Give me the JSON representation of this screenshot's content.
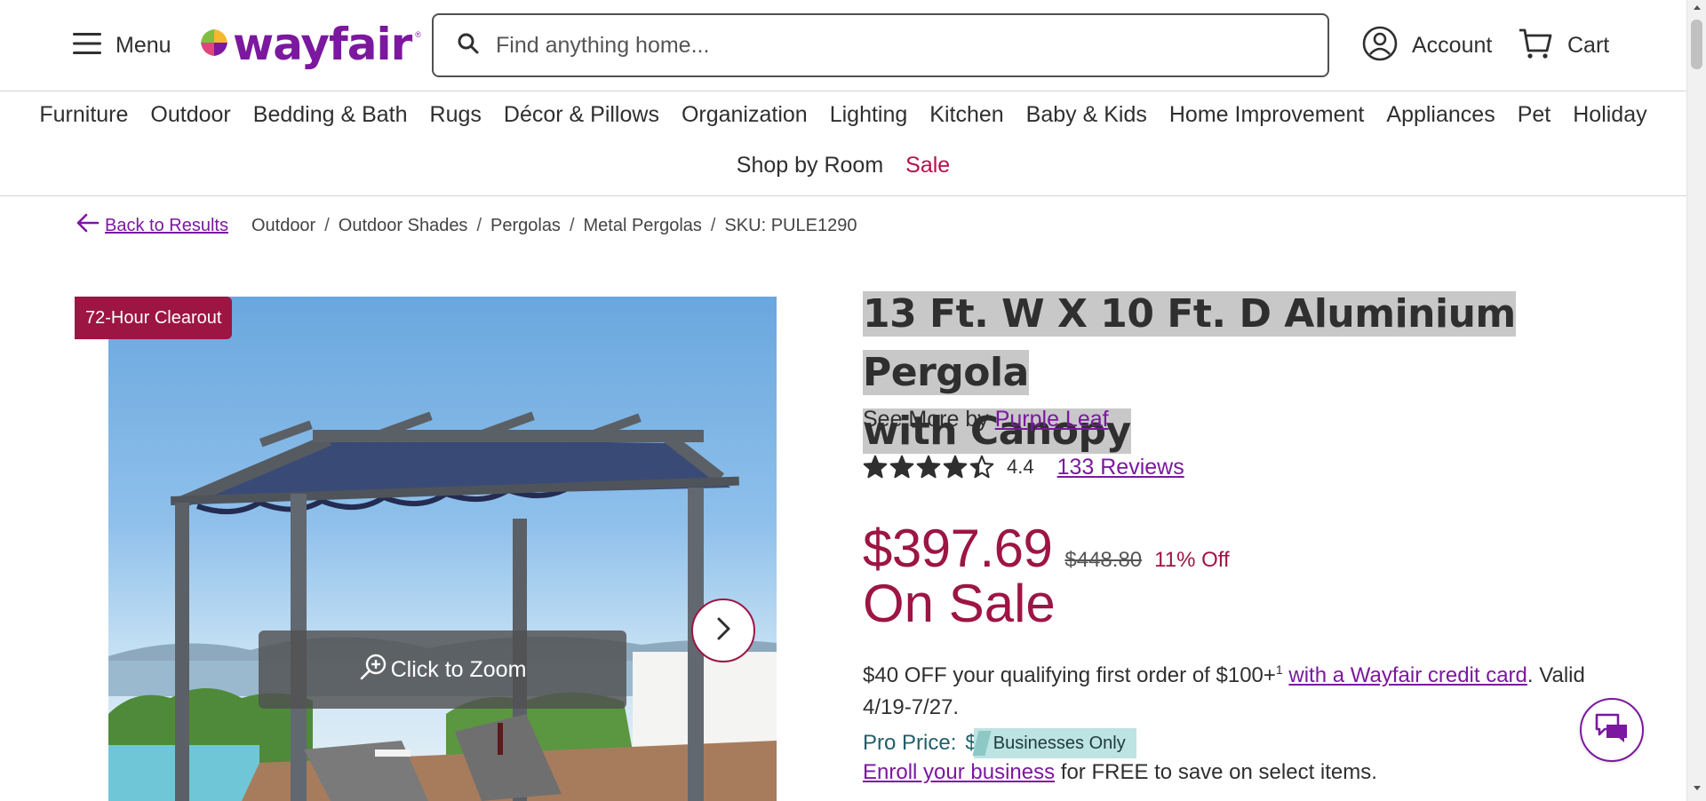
{
  "header": {
    "menu_label": "Menu",
    "logo_text": "wayfair",
    "logo_mark": "®",
    "search_placeholder": "Find anything home...",
    "account_label": "Account",
    "cart_label": "Cart"
  },
  "categories": {
    "row1": [
      "Furniture",
      "Outdoor",
      "Bedding & Bath",
      "Rugs",
      "Décor & Pillows",
      "Organization",
      "Lighting",
      "Kitchen",
      "Baby & Kids",
      "Home Improvement",
      "Appliances",
      "Pet",
      "Holiday"
    ],
    "row2": [
      "Shop by Room",
      "Sale"
    ]
  },
  "breadcrumb": {
    "back_label": "Back to Results",
    "items": [
      "Outdoor",
      "Outdoor Shades",
      "Pergolas",
      "Metal Pergolas"
    ],
    "separator": "/",
    "sku": "SKU: PULE1290"
  },
  "gallery": {
    "badge": "72-Hour Clearout",
    "zoom_label": "Click to Zoom"
  },
  "product": {
    "title_line1": "13 Ft. W X 10 Ft. D Aluminium Pergola",
    "title_line2": "with Canopy",
    "see_more_prefix": "See More by",
    "brand": "Purple Leaf",
    "rating": 4.4,
    "rating_text": "4.4",
    "reviews_label": "133 Reviews",
    "price": "$397.69",
    "old_price": "$448.80",
    "percent_off": "11% Off",
    "sale_label": "On Sale",
    "promo_text_1": "$40 OFF your qualifying first order of $100+",
    "promo_sup": "1",
    "promo_link": "with a Wayfair credit card",
    "promo_text_2": ". Valid 4/19-7/27.",
    "pro_label": "Pro Price:",
    "pro_dollar": "$",
    "business_tag": "Businesses Only",
    "enroll_link": "Enroll your business",
    "enroll_text": " for FREE to save on select items."
  },
  "colors": {
    "brand_purple": "#7b189f",
    "sale_red": "#9d1543",
    "pro_teal": "#1f5f6b",
    "business_tag_bg": "#bde3e2"
  }
}
